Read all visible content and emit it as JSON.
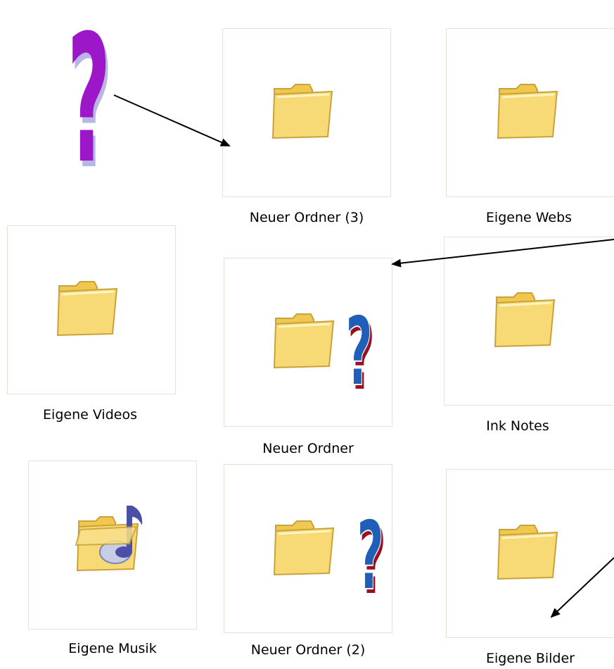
{
  "folders": [
    {
      "name": "Neuer Ordner (3)",
      "icon": "folder-icon"
    },
    {
      "name": "Eigene Webs",
      "icon": "folder-icon"
    },
    {
      "name": "Eigene Videos",
      "icon": "folder-icon"
    },
    {
      "name": "Neuer Ordner",
      "icon": "folder-icon"
    },
    {
      "name": "Ink Notes",
      "icon": "folder-icon"
    },
    {
      "name": "Eigene Musik",
      "icon": "music-folder-icon"
    },
    {
      "name": "Neuer Ordner (2)",
      "icon": "folder-icon"
    },
    {
      "name": "Eigene Bilder",
      "icon": "folder-icon"
    }
  ],
  "annotations": {
    "large_question_mark": "?",
    "small_question_mark": "?",
    "colors": {
      "large_question_mark": "#9b17c8",
      "small_question_mark": "#1f5fb8",
      "small_question_mark_shadow": "#9a1020",
      "arrow": "#000000",
      "folder_fill": "#f7d976",
      "folder_stroke": "#c9a23a"
    }
  }
}
